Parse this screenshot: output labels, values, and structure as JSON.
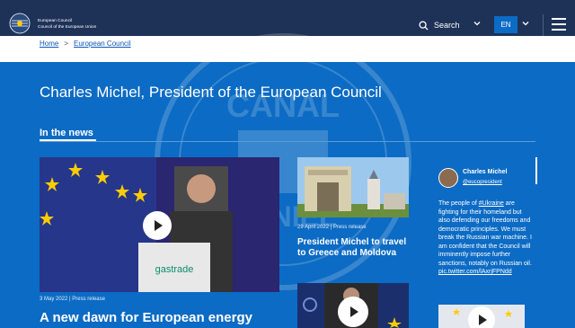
{
  "header": {
    "org_line1": "European Council",
    "org_line2": "Council of the European Union",
    "search_label": "Search",
    "language": "EN"
  },
  "breadcrumb": {
    "home": "Home",
    "separator": ">",
    "current": "European Council"
  },
  "page": {
    "title": "Charles Michel, President of the European Council"
  },
  "news": {
    "section_title": "In the news",
    "main": {
      "date": "3 May 2022",
      "type": "Press release",
      "title": "A new dawn for European energy",
      "image_text": "gastrade"
    },
    "side": [
      {
        "date": "29 April 2022",
        "type": "Press release",
        "title": "President Michel to travel to Greece and Moldova"
      },
      {
        "date": "",
        "type": "",
        "title": ""
      }
    ]
  },
  "twitter": {
    "name": "Charles Michel",
    "handle": "@eucopresident",
    "text_before_tag": "The people of ",
    "hashtag": "#Ukraine",
    "text_after_tag": " are fighting for their homeland but also defending our freedoms and democratic principles. We must break the Russian war machine. I am confident that the Council will imminently impose further sanctions, notably on Russian oil.",
    "link": "pic.twitter.com/lAxrjFPNdd"
  },
  "watermark": {
    "line1": "CANAL",
    "line2": "DANIEL"
  },
  "colors": {
    "header_bg": "#1e3258",
    "page_bg": "#0c6bc4",
    "eu_blue": "#003399",
    "eu_gold": "#ffcc00"
  }
}
